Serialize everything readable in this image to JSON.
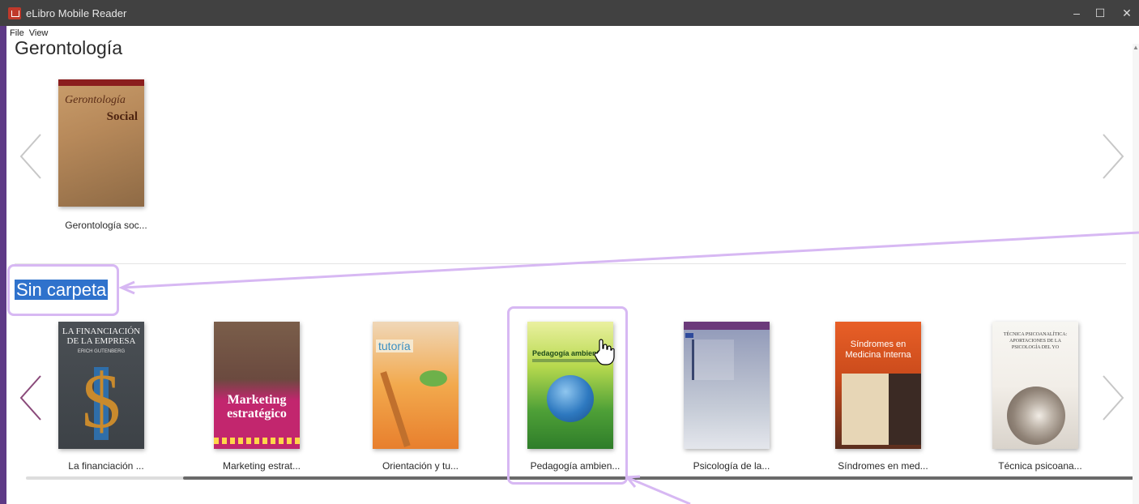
{
  "window": {
    "title": "eLibro Mobile Reader",
    "controls": {
      "minimize": "–",
      "maximize": "☐",
      "close": "✕"
    }
  },
  "menu": [
    "File",
    "View"
  ],
  "sections": [
    {
      "title": "Gerontología",
      "books": [
        {
          "title": "Gerontología soc...",
          "cover_text": [
            "Gerontología",
            "Social"
          ]
        }
      ]
    },
    {
      "title": "Sin carpeta",
      "books": [
        {
          "title": "La financiación ...",
          "cover_text": [
            "LA FINANCIACIÓN DE LA EMPRESA",
            "ERICH GUTENBERG"
          ]
        },
        {
          "title": "Marketing estrat...",
          "cover_text": [
            "Marketing estratégico"
          ]
        },
        {
          "title": "Orientación y tu...",
          "cover_text": [
            "tutoría"
          ]
        },
        {
          "title": "Pedagogía ambien...",
          "cover_text": [
            "Pedagogía ambiental"
          ]
        },
        {
          "title": "Psicología de la...",
          "cover_text": []
        },
        {
          "title": "Síndromes en med...",
          "cover_text": [
            "Síndromes en Medicina Interna"
          ]
        },
        {
          "title": "Técnica psicoana...",
          "cover_text": [
            "TÉCNICA PSICOANALÍTICA:",
            "APORTACIONES DE LA PSICOLOGÍA DEL YO"
          ]
        }
      ]
    }
  ],
  "icons": {
    "prev": "chevron-left-icon",
    "next": "chevron-right-icon"
  },
  "colors": {
    "titlebar": "#414141",
    "highlight": "#2f72cc",
    "annotation": "#d7b8f3"
  }
}
